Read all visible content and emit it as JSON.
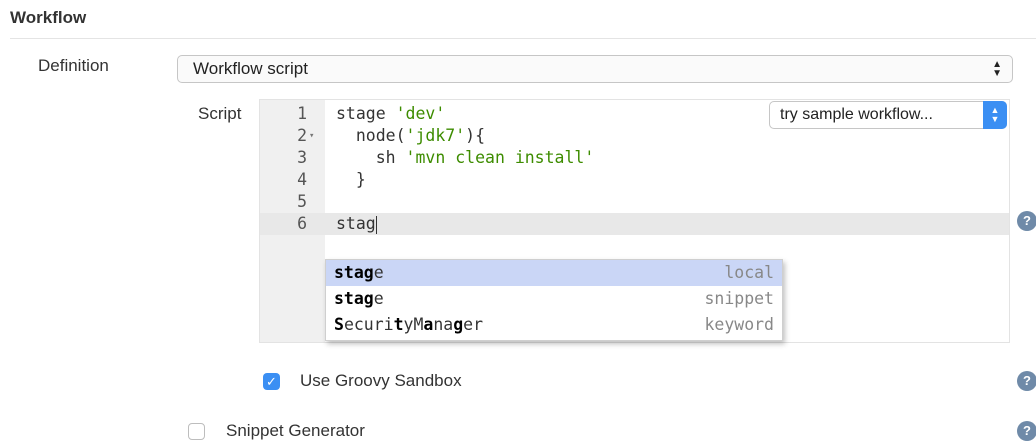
{
  "section": {
    "title": "Workflow"
  },
  "definition": {
    "label": "Definition",
    "value": "Workflow script"
  },
  "script": {
    "label": "Script",
    "sample_select": "try sample workflow...",
    "lines": [
      {
        "num": "1",
        "text": "stage ",
        "str": "'dev'",
        "tail": ""
      },
      {
        "num": "2",
        "text": "  node(",
        "str": "'jdk7'",
        "tail": "){",
        "fold": "▾"
      },
      {
        "num": "3",
        "text": "    sh ",
        "str": "'mvn clean install'",
        "tail": ""
      },
      {
        "num": "4",
        "text": "  }",
        "str": "",
        "tail": ""
      },
      {
        "num": "5",
        "text": "",
        "str": "",
        "tail": ""
      },
      {
        "num": "6",
        "text": "stag",
        "str": "",
        "tail": ""
      }
    ]
  },
  "autocomplete": {
    "items": [
      {
        "parts": [
          {
            "t": "stag",
            "b": true
          },
          {
            "t": "e",
            "b": false
          }
        ],
        "type": "local"
      },
      {
        "parts": [
          {
            "t": "stag",
            "b": true
          },
          {
            "t": "e",
            "b": false
          }
        ],
        "type": "snippet"
      },
      {
        "parts": [
          {
            "t": "S",
            "b": true
          },
          {
            "t": "ecuri",
            "b": false
          },
          {
            "t": "t",
            "b": true
          },
          {
            "t": "yM",
            "b": false
          },
          {
            "t": "a",
            "b": true
          },
          {
            "t": "na",
            "b": false
          },
          {
            "t": "g",
            "b": true
          },
          {
            "t": "er",
            "b": false
          }
        ],
        "type": "keyword"
      }
    ]
  },
  "sandbox": {
    "label": "Use Groovy Sandbox",
    "checked": true
  },
  "snippet": {
    "label": "Snippet Generator",
    "checked": false
  },
  "icons": {
    "help": "help-icon",
    "check": "check-icon"
  },
  "colors": {
    "accent": "#3b8ff3",
    "string": "#3d8c00",
    "selection": "#cad6f6"
  }
}
